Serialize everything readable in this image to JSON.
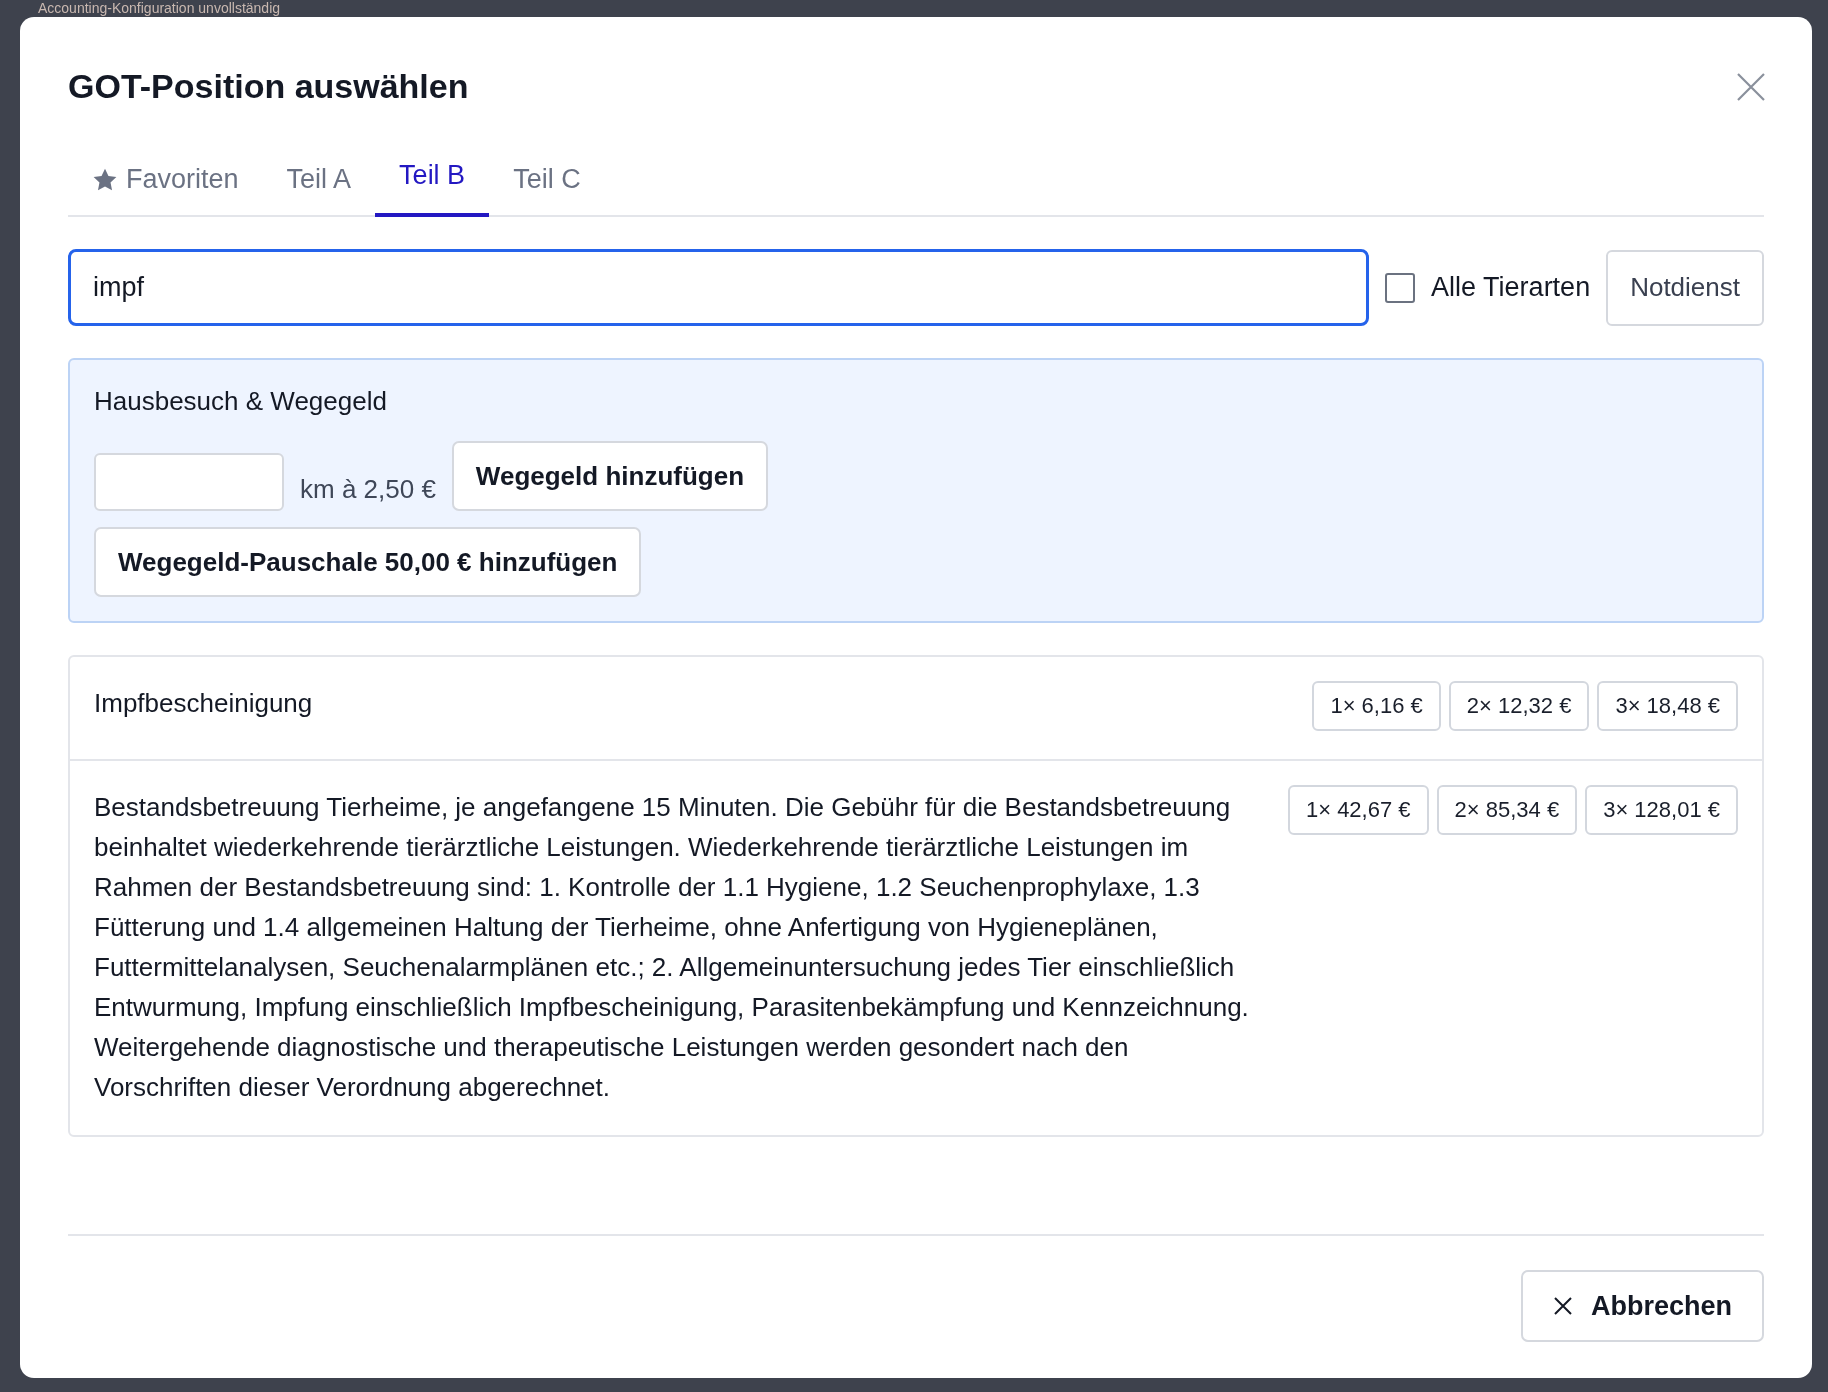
{
  "background": {
    "banner": "Accounting-Konfiguration unvollständig"
  },
  "dialog": {
    "title": "GOT-Position auswählen",
    "tabs": [
      {
        "label": "Favoriten",
        "kind": "star",
        "selected": false
      },
      {
        "label": "Teil A",
        "kind": "plain",
        "selected": false
      },
      {
        "label": "Teil B",
        "kind": "plain",
        "selected": true
      },
      {
        "label": "Teil C",
        "kind": "plain",
        "selected": false
      }
    ],
    "search": {
      "value": "impf"
    },
    "all_species": {
      "label": "Alle Tierarten",
      "checked": false
    },
    "emergency_button": "Notdienst",
    "house_call": {
      "title": "Hausbesuch & Wegegeld",
      "unit": "km à 2,50 €",
      "add_button": "Wegegeld hinzufügen",
      "flat_button": "Wegegeld-Pauschale 50,00 € hinzufügen"
    },
    "results": [
      {
        "text": "Impfbescheinigung",
        "prices": [
          "1× 6,16 €",
          "2× 12,32 €",
          "3× 18,48 €"
        ]
      },
      {
        "text": "Bestandsbetreuung Tierheime, je angefangene 15 Minuten. Die Gebühr für die Bestandsbetreuung beinhaltet wiederkehrende tierärztliche Leistungen. Wiederkehrende tierärztliche Leistungen im Rahmen der Bestandsbetreuung sind: 1. Kontrolle der 1.1 Hygiene, 1.2 Seuchenprophylaxe, 1.3 Fütterung und 1.4 allgemeinen Haltung der Tierheime, ohne Anfertigung von Hygieneplänen, Futtermittelanalysen, Seuchenalarmplänen etc.; 2. Allgemeinuntersuchung jedes Tier einschließlich Entwurmung, Impfung einschließlich Impfbescheinigung, Parasitenbekämpfung und Kennzeichnung. Weitergehende diagnostische und therapeutische Leistungen werden gesondert nach den Vorschriften dieser Verordnung abgerechnet.",
        "prices": [
          "1× 42,67 €",
          "2× 85,34 €",
          "3× 128,01 €"
        ]
      }
    ],
    "cancel_button": "Abbrechen"
  }
}
